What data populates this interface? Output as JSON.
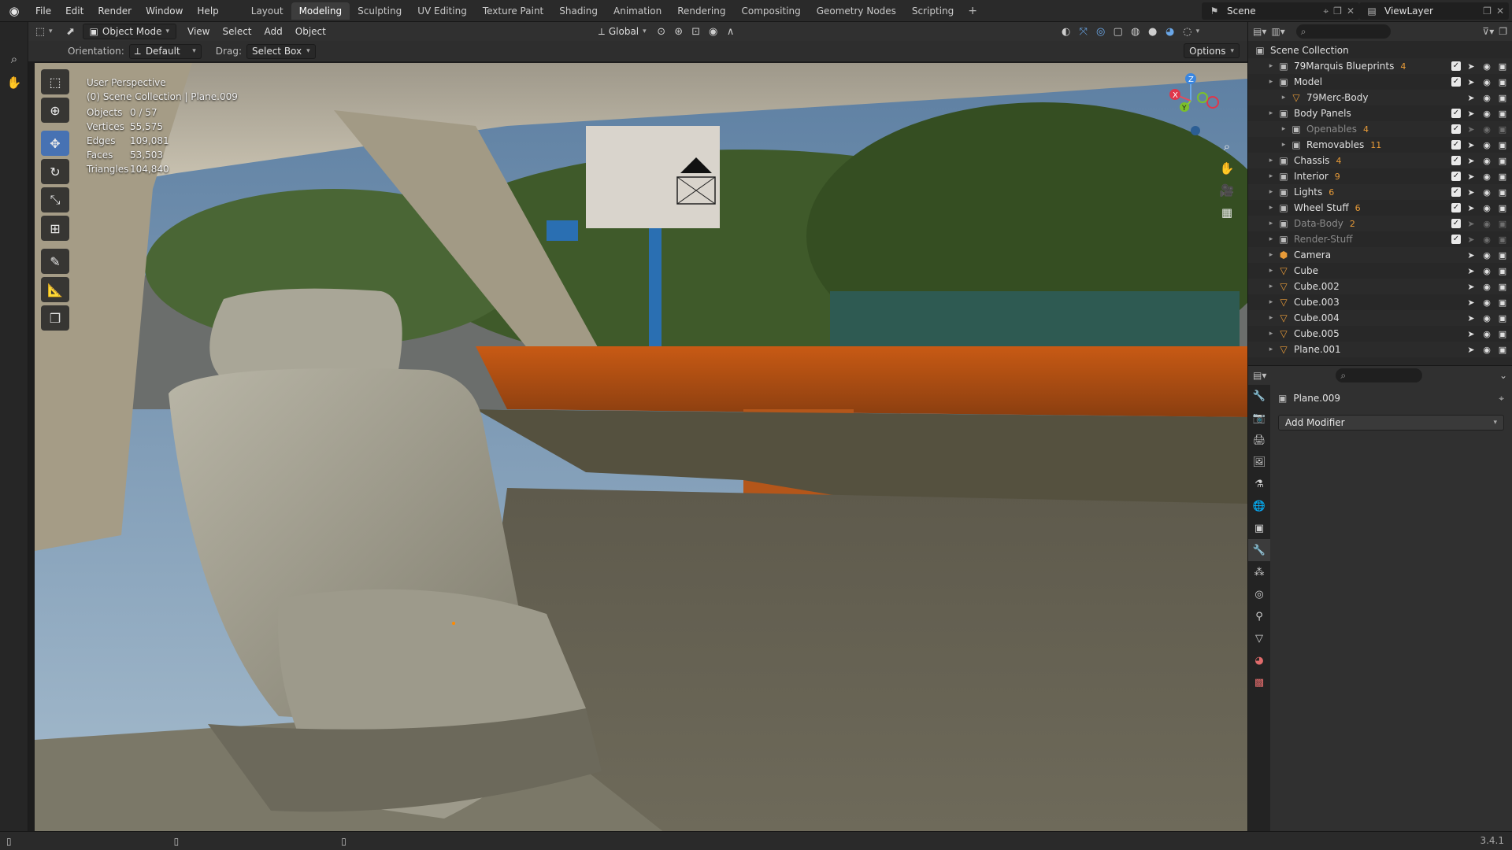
{
  "menu": [
    "File",
    "Edit",
    "Render",
    "Window",
    "Help"
  ],
  "workspaces": [
    "Layout",
    "Modeling",
    "Sculpting",
    "UV Editing",
    "Texture Paint",
    "Shading",
    "Animation",
    "Rendering",
    "Compositing",
    "Geometry Nodes",
    "Scripting"
  ],
  "active_workspace": "Modeling",
  "scene": {
    "name": "Scene",
    "view_layer": "ViewLayer"
  },
  "viewport_header": {
    "mode": "Object Mode",
    "menus": [
      "View",
      "Select",
      "Add",
      "Object"
    ],
    "transform_orientation": "Global"
  },
  "tool_settings": {
    "orientation_label": "Orientation:",
    "orientation_value": "Default",
    "drag_label": "Drag:",
    "drag_value": "Select Box",
    "options_label": "Options"
  },
  "overlay": {
    "view_name": "User Perspective",
    "collection_info": "(0) Scene Collection | Plane.009"
  },
  "stats": [
    {
      "label": "Objects",
      "value": "0 / 57"
    },
    {
      "label": "Vertices",
      "value": "55,575"
    },
    {
      "label": "Edges",
      "value": "109,081"
    },
    {
      "label": "Faces",
      "value": "53,503"
    },
    {
      "label": "Triangles",
      "value": "104,840"
    }
  ],
  "outliner": {
    "root": "Scene Collection",
    "rows": [
      {
        "name": "79Marquis Blueprints",
        "indent": 1,
        "icon": "collection-icon",
        "extra": "4",
        "dim": false
      },
      {
        "name": "Model",
        "indent": 1,
        "icon": "collection-icon",
        "extra": "",
        "dim": false
      },
      {
        "name": "79Merc-Body",
        "indent": 2,
        "icon": "mesh-object-icon",
        "extra": "",
        "dim": false
      },
      {
        "name": "Body Panels",
        "indent": 1,
        "icon": "collection-icon",
        "extra": "",
        "dim": false
      },
      {
        "name": "Openables",
        "indent": 2,
        "icon": "collection-icon",
        "extra": "4",
        "dim": true
      },
      {
        "name": "Removables",
        "indent": 2,
        "icon": "collection-icon",
        "extra": "11",
        "dim": false
      },
      {
        "name": "Chassis",
        "indent": 1,
        "icon": "collection-icon",
        "extra": "4",
        "dim": false
      },
      {
        "name": "Interior",
        "indent": 1,
        "icon": "collection-icon",
        "extra": "9",
        "dim": false
      },
      {
        "name": "Lights",
        "indent": 1,
        "icon": "collection-icon",
        "extra": "6",
        "dim": false
      },
      {
        "name": "Wheel Stuff",
        "indent": 1,
        "icon": "collection-icon",
        "extra": "6",
        "dim": false
      },
      {
        "name": "Data-Body",
        "indent": 1,
        "icon": "collection-icon",
        "extra": "2",
        "dim": true
      },
      {
        "name": "Render-Stuff",
        "indent": 1,
        "icon": "collection-icon",
        "extra": "",
        "dim": true
      },
      {
        "name": "Camera",
        "indent": 1,
        "icon": "camera-object-icon",
        "extra": "",
        "dim": false
      },
      {
        "name": "Cube",
        "indent": 1,
        "icon": "mesh-object-icon",
        "extra": "",
        "dim": false
      },
      {
        "name": "Cube.002",
        "indent": 1,
        "icon": "mesh-object-icon",
        "extra": "",
        "dim": false
      },
      {
        "name": "Cube.003",
        "indent": 1,
        "icon": "mesh-object-icon",
        "extra": "",
        "dim": false
      },
      {
        "name": "Cube.004",
        "indent": 1,
        "icon": "mesh-object-icon",
        "extra": "",
        "dim": false
      },
      {
        "name": "Cube.005",
        "indent": 1,
        "icon": "mesh-object-icon",
        "extra": "",
        "dim": false
      },
      {
        "name": "Plane.001",
        "indent": 1,
        "icon": "mesh-object-icon",
        "extra": "",
        "dim": false
      }
    ]
  },
  "properties": {
    "object_name": "Plane.009",
    "add_modifier_label": "Add Modifier",
    "active_tab": "modifier-tab"
  },
  "version": "3.4.1",
  "colors": {
    "accent": "#4772b3",
    "outliner_collection": "#e0e0e0",
    "mesh_icon": "#e89b38",
    "modifier_icon": "#6aa7e8",
    "data_icon": "#7fd06b"
  }
}
